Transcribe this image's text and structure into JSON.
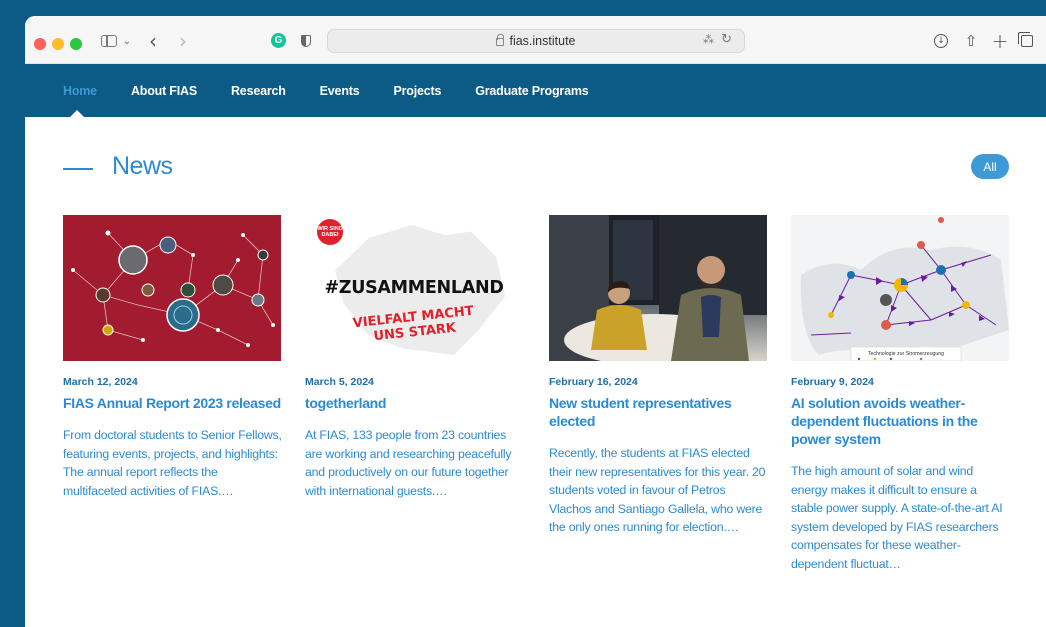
{
  "browser": {
    "url": "fias.institute"
  },
  "nav": {
    "items": [
      {
        "label": "Home",
        "active": true
      },
      {
        "label": "About FIAS",
        "active": false
      },
      {
        "label": "Research",
        "active": false
      },
      {
        "label": "Events",
        "active": false
      },
      {
        "label": "Projects",
        "active": false
      },
      {
        "label": "Graduate Programs",
        "active": false
      }
    ]
  },
  "news": {
    "title": "News",
    "all_label": "All",
    "cards": [
      {
        "date": "March 12, 2024",
        "title": "FIAS Annual Report 2023 released",
        "excerpt": "From doctoral students to Senior Fellows, featuring events, projects, and highlights: The annual report reflects the multifaceted activities of FIAS.…"
      },
      {
        "date": "March 5, 2024",
        "title": "togetherland",
        "excerpt": "At FIAS, 133 people from 23 countries are working and researching peacefully and productively on our future together with international guests.…",
        "image_text": {
          "badge": "WIR SIND DABEI",
          "headline": "#ZUSAMMENLAND",
          "sub_line1": "VIELFALT MACHT",
          "sub_line2": "UNS STARK"
        }
      },
      {
        "date": "February 16, 2024",
        "title": "New student representatives elected",
        "excerpt": "Recently, the students at FIAS elected their new representatives for this year. 20 students voted in favour of Petros Vlachos and Santiago Gallela, who were the only ones running for election.…"
      },
      {
        "date": "February 9, 2024",
        "title": "AI solution avoids weather-dependent fluctuations in the power system",
        "excerpt": "The high amount of solar and wind energy makes it difficult to ensure a stable power supply. A state-of-the-art AI system developed by FIAS researchers compensates for these weather-dependent fluctuat…",
        "image_text": {
          "legend_title": "Technologie zur Stromerzeugung"
        }
      }
    ]
  },
  "colors": {
    "brand_dark": "#0c5a86",
    "accent": "#2c8ad0",
    "button": "#3d9ad6"
  },
  "icons": [
    "sidebar-icon",
    "chevron-down-icon",
    "back-icon",
    "forward-icon",
    "grammarly-icon",
    "shield-icon",
    "lock-icon",
    "translate-icon",
    "reload-icon",
    "download-icon",
    "share-icon",
    "new-tab-icon",
    "tabs-overview-icon"
  ]
}
